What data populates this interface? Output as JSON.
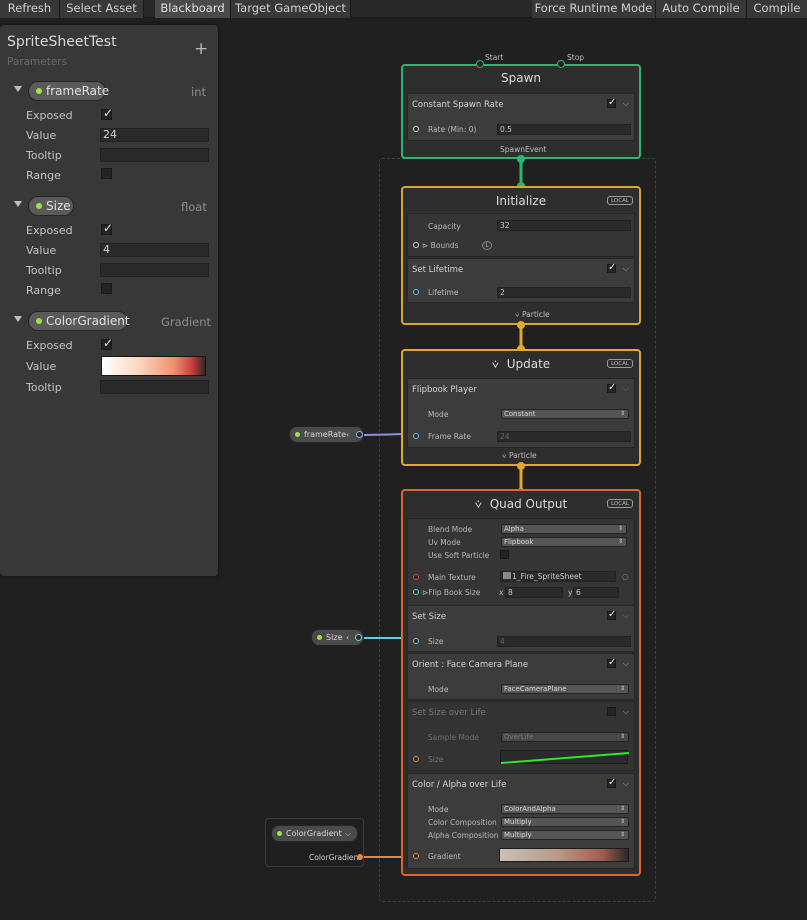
{
  "toolbar": {
    "refresh": "Refresh",
    "select_asset": "Select Asset",
    "blackboard": "Blackboard",
    "target": "Target GameObject",
    "force_runtime": "Force Runtime Mode",
    "auto_compile": "Auto Compile",
    "compile": "Compile"
  },
  "blackboard": {
    "title": "SpriteSheetTest",
    "subtitle": "Parameters",
    "add_icon": "plus-icon",
    "labels": {
      "exposed": "Exposed",
      "value": "Value",
      "tooltip": "Tooltip",
      "range": "Range"
    },
    "params": [
      {
        "name": "frameRate",
        "type": "int",
        "value": "24"
      },
      {
        "name": "Size",
        "type": "float",
        "value": "4"
      },
      {
        "name": "ColorGradient",
        "type": "Gradient"
      }
    ]
  },
  "graph": {
    "spawn": {
      "title": "Spawn",
      "start": "Start",
      "stop": "Stop",
      "block": "Constant Spawn Rate",
      "rate_label": "Rate (Min: 0)",
      "rate_value": "0.5",
      "event": "SpawnEvent"
    },
    "initialize": {
      "title": "Initialize",
      "badge": "LOCAL",
      "capacity_label": "Capacity",
      "capacity_value": "32",
      "bounds_label": "Bounds",
      "bounds_badge": "L",
      "block": "Set Lifetime",
      "lifetime_label": "Lifetime",
      "lifetime_value": "2",
      "particle": "Particle"
    },
    "update": {
      "title": "Update",
      "badge": "LOCAL",
      "block": "Flipbook Player",
      "mode_label": "Mode",
      "mode_value": "Constant",
      "framerate_label": "Frame Rate",
      "framerate_value": "24",
      "particle": "Particle"
    },
    "output": {
      "title": "Quad Output",
      "badge": "LOCAL",
      "blend_label": "Blend Mode",
      "blend_value": "Alpha",
      "uv_label": "Uv Mode",
      "uv_value": "Flipbook",
      "soft_label": "Use Soft Particle",
      "texture_label": "Main Texture",
      "texture_value": "1_Fire_SpriteSheet",
      "flip_label": "Flip Book Size",
      "flip_x_label": "x",
      "flip_x": "8",
      "flip_y_label": "y",
      "flip_y": "6",
      "set_size": "Set Size",
      "size_label": "Size",
      "size_value": "4",
      "orient": "Orient : Face Camera Plane",
      "orient_mode_label": "Mode",
      "orient_mode_value": "FaceCameraPlane",
      "sol": "Set Size over Life",
      "sol_sample_label": "Sample Mode",
      "sol_sample_value": "OverLife",
      "sol_size_label": "Size",
      "color": "Color / Alpha over Life",
      "color_mode_label": "Mode",
      "color_mode_value": "ColorAndAlpha",
      "color_comp_label": "Color Composition",
      "color_comp_value": "Multiply",
      "alpha_comp_label": "Alpha Composition",
      "alpha_comp_value": "Multiply",
      "gradient_label": "Gradient"
    },
    "nodes": {
      "framerate": "frameRate",
      "size": "Size",
      "colorgradient": "ColorGradient",
      "colorgradient_out": "ColorGradient"
    }
  },
  "colors": {
    "spawn": "#2fb473",
    "initialize": "#d6a533",
    "update": "#e2a82a",
    "output": "#d9672f",
    "param_dot": "#9ae24a"
  }
}
